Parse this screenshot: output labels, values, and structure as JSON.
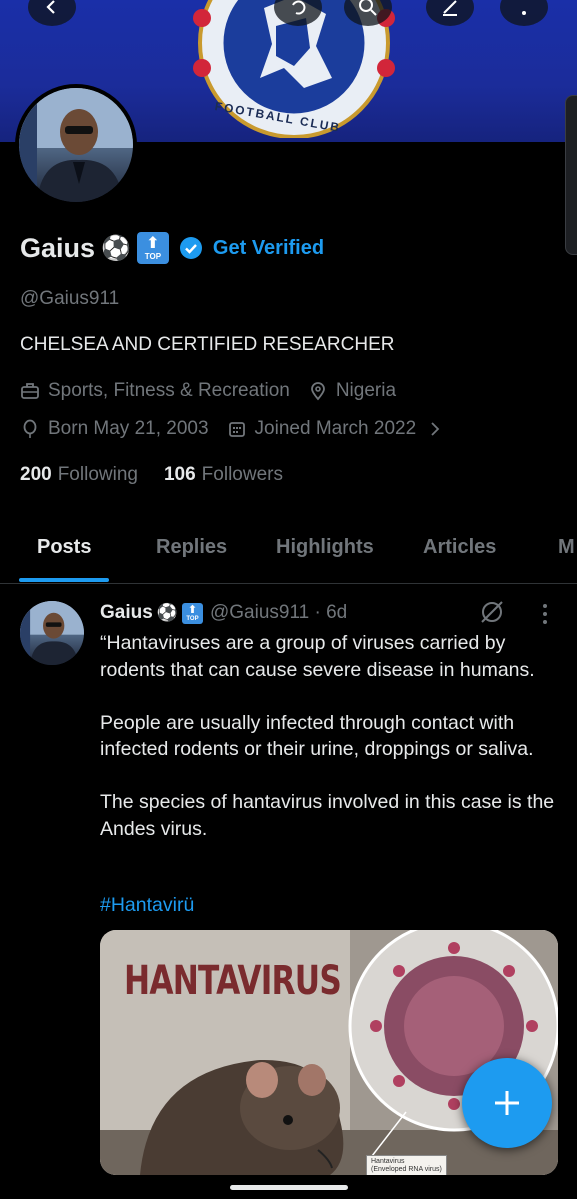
{
  "profile": {
    "name": "Gaius",
    "name_emoji": "⚽",
    "badge_arrow": "⬆",
    "badge_text": "TOP",
    "get_verified_label": "Get Verified",
    "handle": "@Gaius911",
    "bio": "CHELSEA AND CERTIFIED RESEARCHER",
    "category": "Sports, Fitness & Recreation",
    "location": "Nigeria",
    "born": "Born May 21, 2003",
    "joined": "Joined March 2022",
    "following_count": "200",
    "following_label": "Following",
    "followers_count": "106",
    "followers_label": "Followers"
  },
  "banner": {
    "crest_text": "FOOTBALL CLUB"
  },
  "tabs": [
    {
      "label": "Posts"
    },
    {
      "label": "Replies"
    },
    {
      "label": "Highlights"
    },
    {
      "label": "Articles"
    },
    {
      "label": "M"
    }
  ],
  "post": {
    "author": "Gaius",
    "handle_time": "@Gaius911 · 6d",
    "body": "“Hantaviruses are a group of viruses carried by rodents that can cause severe disease in humans.\n\nPeople are usually infected through contact with infected rodents or their urine, droppings or saliva.\n\nThe species of hantavirus involved in this case is the Andes virus.",
    "hashtag": "#Hantavirü",
    "media_title": "HANTAVIRUS",
    "media_label_1": "Hantavirus",
    "media_label_2": "(Enveloped RNA virus)"
  },
  "colors": {
    "accent": "#1d9bf0",
    "background": "#000000",
    "banner": "#1b2c9a",
    "muted_text": "#71767b"
  },
  "icons": {
    "back": "arrow-left-icon",
    "search": "search-icon",
    "compose": "compose-icon",
    "more": "more-vertical-icon",
    "category": "briefcase-icon",
    "location": "location-pin-icon",
    "born": "balloon-icon",
    "joined": "calendar-icon",
    "grok": "grok-icon",
    "fab": "plus-icon"
  }
}
